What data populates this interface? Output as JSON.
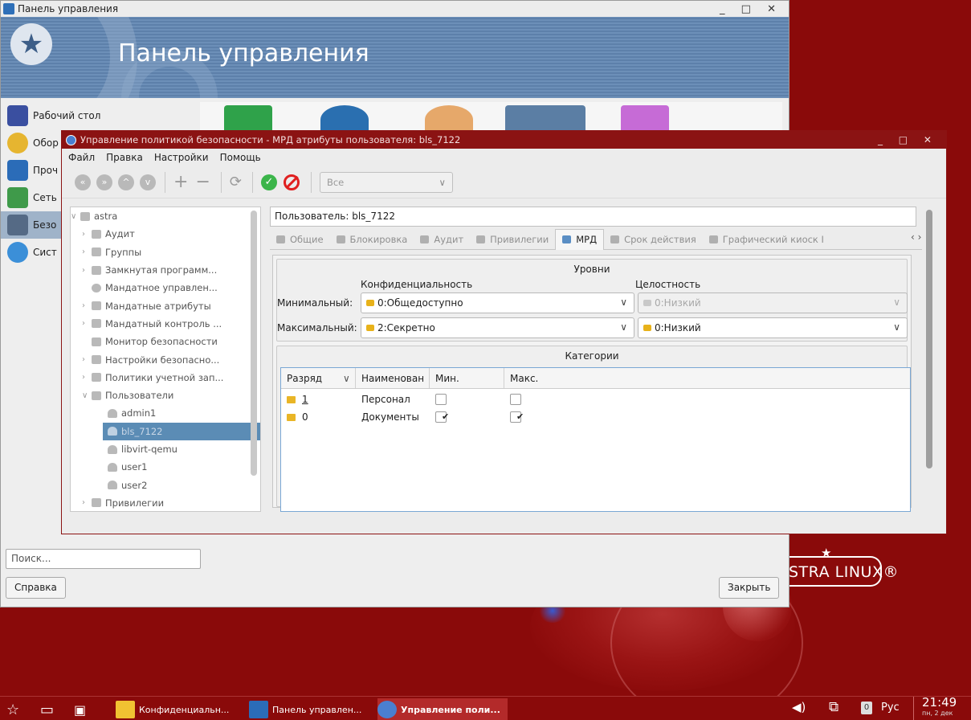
{
  "main_window": {
    "title": "Панель управления",
    "banner_title": "Панель управления",
    "controls": "_ □ ✕",
    "sidebar": [
      "Рабочий стол",
      "Обор",
      "Проч",
      "Сеть",
      "Безо",
      "Сист"
    ],
    "search_placeholder": "Поиск...",
    "help_button": "Справка",
    "close_button": "Закрыть"
  },
  "desktop": {
    "logo_text": "STRA LINUX®",
    "logo_star": "★"
  },
  "dialog": {
    "title": "Управление политикой безопасности - МРД атрибуты пользователя: bls_7122",
    "controls": "_ □ ✕",
    "menu": [
      "Файл",
      "Правка",
      "Настройки",
      "Помощь"
    ],
    "toolbar": {
      "filter_value": "Все"
    },
    "tree": {
      "root": "astra",
      "items": [
        "Аудит",
        "Группы",
        "Замкнутая программ...",
        "Мандатное управлен...",
        "Мандатные атрибуты",
        "Мандатный контроль ...",
        "Монитор безопасности",
        "Настройки безопасно...",
        "Политики учетной зап...",
        "Пользователи"
      ],
      "users": [
        "admin1",
        "bls_7122",
        "libvirt-qemu",
        "user1",
        "user2"
      ],
      "last": "Привилегии"
    },
    "user_field": "Пользователь: bls_7122",
    "tabs": [
      "Общие",
      "Блокировка",
      "Аудит",
      "Привилегии",
      "МРД",
      "Срок действия",
      "Графический киоск I"
    ],
    "levels": {
      "title": "Уровни",
      "conf_label": "Конфиденциальность",
      "integrity_label": "Целостность",
      "min_label": "Минимальный:",
      "max_label": "Максимальный:",
      "min_conf": "0:Общедоступно",
      "min_int": "0:Низкий",
      "max_conf": "2:Секретно",
      "max_int": "0:Низкий"
    },
    "categories": {
      "title": "Категории",
      "columns": [
        "Разряд",
        "Наименован",
        "Мин.",
        "Макс."
      ],
      "rows": [
        {
          "bit": "1",
          "name": "Персонал",
          "min": false,
          "max": false
        },
        {
          "bit": "0",
          "name": "Документы",
          "min": true,
          "max": true
        }
      ]
    }
  },
  "taskbar": {
    "items": [
      "Конфиденциальн...",
      "Панель управлен...",
      "Управление поли..."
    ],
    "lang": "Рус",
    "badge": "0",
    "time": "21:49",
    "date": "пн, 2 дек"
  }
}
